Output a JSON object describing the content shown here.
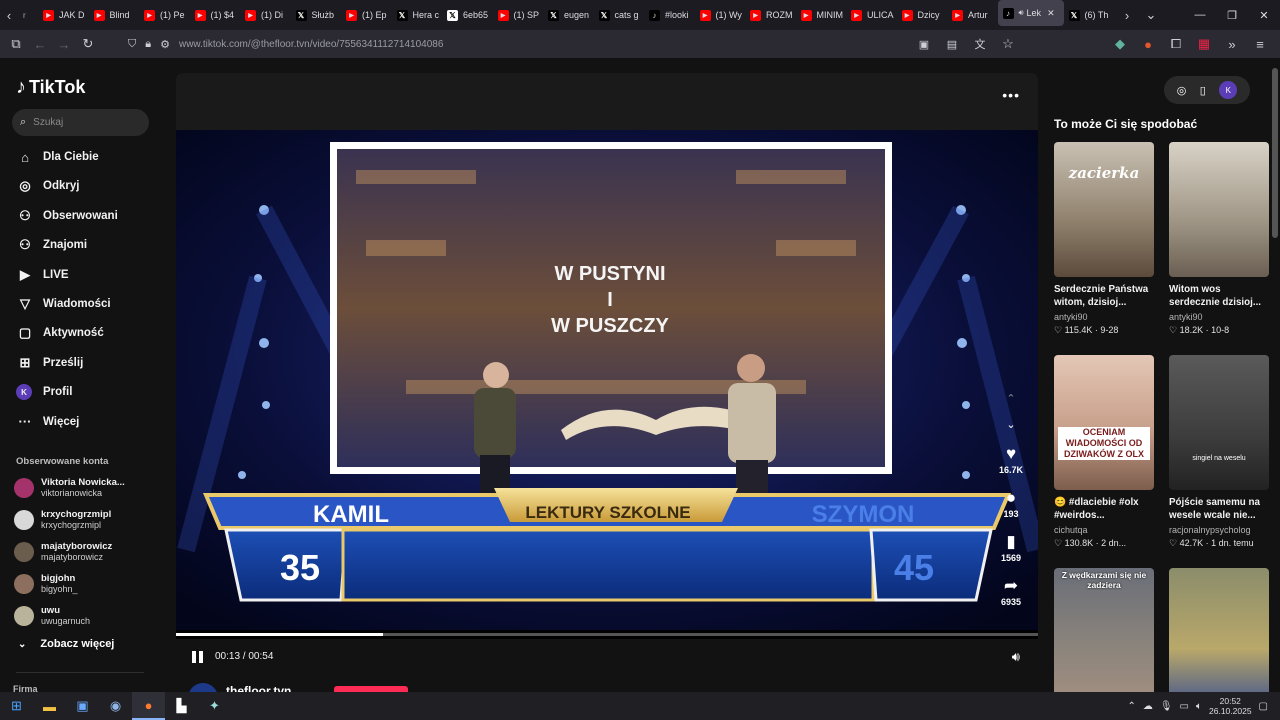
{
  "browser": {
    "tabs": [
      {
        "label": "JAK D",
        "icon": "youtube-icon",
        "color": "#ff0000"
      },
      {
        "label": "Blind",
        "icon": "youtube-icon",
        "color": "#ff0000"
      },
      {
        "label": "(1) Pe",
        "icon": "youtube-icon",
        "color": "#ff0000"
      },
      {
        "label": "(1) $4",
        "icon": "youtube-icon",
        "color": "#ff0000"
      },
      {
        "label": "(1) Di",
        "icon": "youtube-icon",
        "color": "#ff0000"
      },
      {
        "label": "Służb",
        "icon": "x-icon",
        "color": "#000000"
      },
      {
        "label": "(1) Ep",
        "icon": "youtube-icon",
        "color": "#ff0000"
      },
      {
        "label": "Hera c",
        "icon": "x-icon",
        "color": "#000000"
      },
      {
        "label": "6eb65",
        "icon": "x-icon",
        "color": "#ffffff"
      },
      {
        "label": "(1) SP",
        "icon": "youtube-icon",
        "color": "#ff0000"
      },
      {
        "label": "eugen",
        "icon": "x-icon",
        "color": "#000000"
      },
      {
        "label": "cats g",
        "icon": "x-icon",
        "color": "#000000"
      },
      {
        "label": "#looki",
        "icon": "tiktok-icon",
        "color": "#000000"
      },
      {
        "label": "(1) Wy",
        "icon": "youtube-icon",
        "color": "#ff0000"
      },
      {
        "label": "ROZM",
        "icon": "youtube-icon",
        "color": "#ff0000"
      },
      {
        "label": "MINIM",
        "icon": "youtube-icon",
        "color": "#ff0000"
      },
      {
        "label": "ULICA",
        "icon": "youtube-icon",
        "color": "#ff0000"
      },
      {
        "label": "Dzicy",
        "icon": "youtube-icon",
        "color": "#ff0000"
      },
      {
        "label": "Artur",
        "icon": "youtube-icon",
        "color": "#ff0000"
      },
      {
        "label": "Lek",
        "icon": "tiktok-icon",
        "color": "#000000",
        "active": true
      },
      {
        "label": "(6) Th",
        "icon": "x-icon",
        "color": "#000000"
      }
    ],
    "url": "www.tiktok.com/@thefloor.tvn/video/7556341112714104086"
  },
  "tiktok": {
    "logo": "TikTok",
    "search_placeholder": "Szukaj",
    "nav": [
      {
        "label": "Dla Ciebie",
        "icon": "home-icon"
      },
      {
        "label": "Odkryj",
        "icon": "compass-icon"
      },
      {
        "label": "Obserwowani",
        "icon": "following-icon"
      },
      {
        "label": "Znajomi",
        "icon": "friends-icon"
      },
      {
        "label": "LIVE",
        "icon": "live-icon"
      },
      {
        "label": "Wiadomości",
        "icon": "messages-icon"
      },
      {
        "label": "Aktywność",
        "icon": "activity-icon"
      },
      {
        "label": "Prześlij",
        "icon": "upload-icon"
      },
      {
        "label": "Profil",
        "icon": "profile-avatar",
        "avatar_letter": "K"
      },
      {
        "label": "Więcej",
        "icon": "more-icon"
      }
    ],
    "followed_title": "Obserwowane konta",
    "followed": [
      {
        "name": "Viktoria Nowicka...",
        "handle": "viktorianowicka",
        "color": "#a4336b"
      },
      {
        "name": "krxychogrzmipl",
        "handle": "krxychogrzmipl",
        "color": "#d8d8d8"
      },
      {
        "name": "majatyborowicz",
        "handle": "majatyborowicz",
        "color": "#6b5d4e"
      },
      {
        "name": "bigjohn",
        "handle": "bigyohn_",
        "color": "#8c6f5e"
      },
      {
        "name": "uwu",
        "handle": "uwugarnuch",
        "color": "#b8b39a"
      }
    ],
    "see_more": "Zobacz więcej",
    "company": "Firma"
  },
  "video": {
    "overlay": {
      "title_lines": [
        "W PUSTYNI",
        "I",
        "W PUSZCZY"
      ],
      "left_name": "KAMIL",
      "category": "LEKTURY SZKOLNE",
      "right_name": "SZYMON",
      "left_score": "35",
      "right_score": "45"
    },
    "time": "00:13 / 00:54",
    "progress": 0.24,
    "creator": "thefloor.tvn",
    "actions": {
      "likes": "16.7K",
      "comments": "193",
      "saves": "1569",
      "shares": "6935"
    }
  },
  "recommended": {
    "title": "To może Ci się spodobać",
    "cards": [
      {
        "title": "Serdecznie Państwa witom, dzisioj...",
        "author": "antyki90",
        "stats": "♡ 115.4K · 9-28",
        "overlay": "zacierka"
      },
      {
        "title": "Witom wos serdecznie dzisioj...",
        "author": "antyki90",
        "stats": "♡ 18.2K · 10-8",
        "overlay": ""
      },
      {
        "title": "😊 #dlaciebie #olx #weirdos...",
        "author": "cichutqa",
        "stats": "♡ 130.8K · 2 dn...",
        "overlay": "OCENIAM WIADOMOŚCI OD DZIWAKÓW Z OLX"
      },
      {
        "title": "Pójście samemu na wesele wcale nie...",
        "author": "racjonalnypsycholog",
        "stats": "♡ 42.7K · 1 dn. temu",
        "overlay": "singiel na weselu"
      },
      {
        "title": "",
        "author": "",
        "stats": "",
        "overlay": "Z wędkarzami się nie zadziera"
      },
      {
        "title": "",
        "author": "",
        "stats": "",
        "overlay": ""
      }
    ]
  },
  "taskbar": {
    "time": "20:52",
    "date": "26.10.2025"
  }
}
